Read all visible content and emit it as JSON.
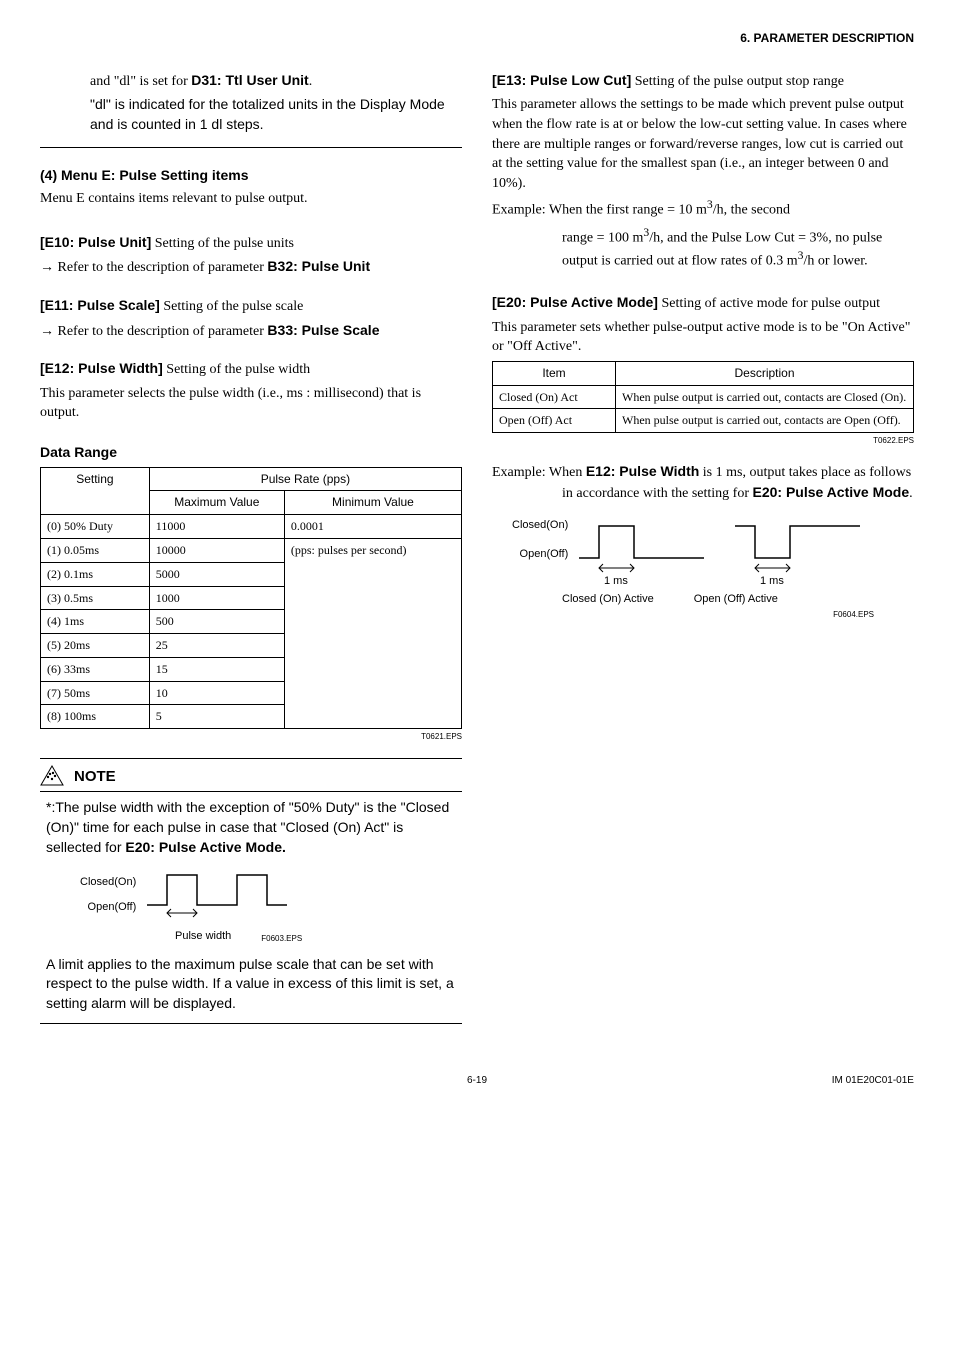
{
  "header": {
    "chapter": "6.  PARAMETER DESCRIPTION"
  },
  "left": {
    "intro1a": "and \"dl\" is set for ",
    "intro1b": "D31: Ttl User Unit",
    "intro1c": ".",
    "intro2": "\"dl\" is indicated for the totalized units in the Display Mode and is counted in 1 dl steps.",
    "heading4": "(4) Menu E: Pulse Setting items",
    "heading4_desc": "Menu E contains items relevant to pulse output.",
    "e10_head": "[E10: Pulse Unit]",
    "e10_rest": " Setting of the pulse units",
    "e10_ref1": " Refer to the description of parameter ",
    "e10_ref2": "B32: Pulse Unit",
    "e11_head": "[E11: Pulse Scale]",
    "e11_rest": " Setting of the pulse scale",
    "e11_ref1": " Refer to the description of parameter ",
    "e11_ref2": "B33: Pulse Scale",
    "e12_head": "[E12: Pulse Width]",
    "e12_rest": " Setting of the pulse width",
    "e12_para": "This parameter selects the pulse width (i.e., ms : millisecond) that is output.",
    "data_range_heading": "Data Range",
    "table1": {
      "col_setting": "Setting",
      "col_rate": "Pulse Rate (pps)",
      "col_max": "Maximum Value",
      "col_min": "Minimum Value",
      "rows": [
        {
          "setting": "(0) 50% Duty",
          "max": "11000",
          "min": "0.0001"
        },
        {
          "setting": "(1) 0.05ms",
          "max": "10000",
          "min": "(pps: pulses per second)"
        },
        {
          "setting": "(2) 0.1ms",
          "max": "5000",
          "min": ""
        },
        {
          "setting": "(3) 0.5ms",
          "max": "1000",
          "min": ""
        },
        {
          "setting": "(4) 1ms",
          "max": "500",
          "min": ""
        },
        {
          "setting": "(5) 20ms",
          "max": "25",
          "min": ""
        },
        {
          "setting": "(6) 33ms",
          "max": "15",
          "min": ""
        },
        {
          "setting": "(7) 50ms",
          "max": "10",
          "min": ""
        },
        {
          "setting": "(8) 100ms",
          "max": "5",
          "min": ""
        }
      ],
      "eps": "T0621.EPS"
    },
    "note_label": "NOTE",
    "note_body1": "*:The pulse width with the exception of \"50% Duty\" is the \"Closed (On)\" time for each pulse in case that \"Closed (On) Act\" is sellected for ",
    "note_body1b": "E20: Pulse Active Mode.",
    "fig_closed": "Closed(On)",
    "fig_open": "Open(Off)",
    "fig_pw": "Pulse width",
    "fig_eps": "F0603.EPS",
    "note_body2": "A limit applies to the maximum pulse scale that can be set with respect to the pulse width. If a value in excess of this limit is set, a setting alarm will be displayed."
  },
  "right": {
    "e13_head": "[E13: Pulse Low Cut]",
    "e13_rest": " Setting of the pulse output stop range",
    "e13_para": "This parameter allows the settings to be made which prevent pulse output when the flow rate is at or below the low-cut setting value. In cases where there are multiple ranges or forward/reverse ranges, low cut is carried out at the setting value for the smallest span (i.e., an integer between 0 and 10%).",
    "e13_ex1a": "Example:  When the first range = 10 m",
    "e13_ex1b": "/h, the second",
    "e13_ex2a": "range = 100 m",
    "e13_ex2b": "/h, and the Pulse Low Cut = 3%, no pulse output is carried out at flow rates of 0.3 m",
    "e13_ex2c": "/h or lower.",
    "e20_head": "[E20: Pulse Active Mode]",
    "e20_rest": " Setting of active mode for pulse output",
    "e20_para": "This parameter sets whether pulse-output active mode is to be \"On Active\" or \"Off Active\".",
    "table2": {
      "col_item": "Item",
      "col_desc": "Description",
      "rows": [
        {
          "item": "Closed (On) Act",
          "desc": "When pulse output is carried out, contacts are Closed (On)."
        },
        {
          "item": "Open (Off) Act",
          "desc": "When pulse output is carried out, contacts are Open (Off)."
        }
      ],
      "eps": "T0622.EPS"
    },
    "e20_ex1a": "Example:  When ",
    "e20_ex1b": "E12: Pulse Width",
    "e20_ex1c": " is 1 ms, output takes place as follows in accordance with the setting for ",
    "e20_ex1d": "E20: Pulse Active Mode",
    "e20_ex1e": ".",
    "fig2_closed": "Closed(On)",
    "fig2_open": "Open(Off)",
    "fig2_ms": "1 ms",
    "fig2_ca": "Closed (On) Active",
    "fig2_oa": "Open (Off) Active",
    "fig2_eps": "F0604.EPS"
  },
  "footer": {
    "page": "6-19",
    "im": "IM 01E20C01-01E"
  }
}
